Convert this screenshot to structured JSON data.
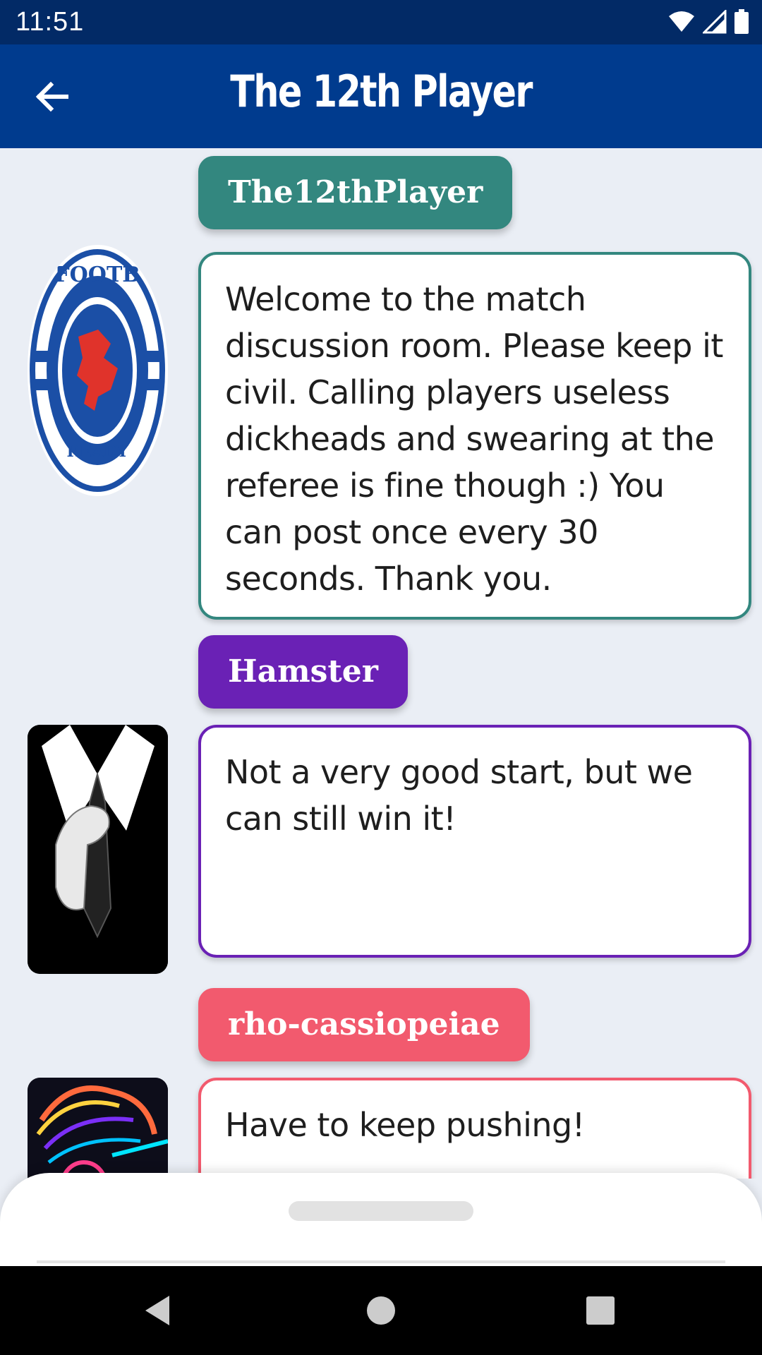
{
  "status_bar": {
    "time": "11:51"
  },
  "app_bar": {
    "title": "The 12th Player"
  },
  "messages": [
    {
      "user": "The12thPlayer",
      "color": "#33877f",
      "avatar": "rangers-crest",
      "text": "Welcome to the match discussion room. Please keep it civil. Calling players useless dickheads and swearing at the referee is fine though :) You can post once every 30 seconds. Thank you.",
      "avatar_badge_top": "FOOTB",
      "avatar_badge_bottom": "READY"
    },
    {
      "user": "Hamster",
      "color": "#6a21b5",
      "avatar": "suit-tie-figure",
      "text": "Not a very good start, but we can still win it!"
    },
    {
      "user": "rho-cassiopeiae",
      "color": "#f25a6e",
      "avatar": "neon-portrait",
      "text": "Have to keep pushing!"
    }
  ],
  "icons": {
    "back": "arrow-left-icon",
    "wifi": "wifi-icon",
    "signal": "signal-icon",
    "battery": "battery-icon",
    "nav_back": "triangle-back-icon",
    "nav_home": "circle-home-icon",
    "nav_recents": "square-recents-icon"
  }
}
